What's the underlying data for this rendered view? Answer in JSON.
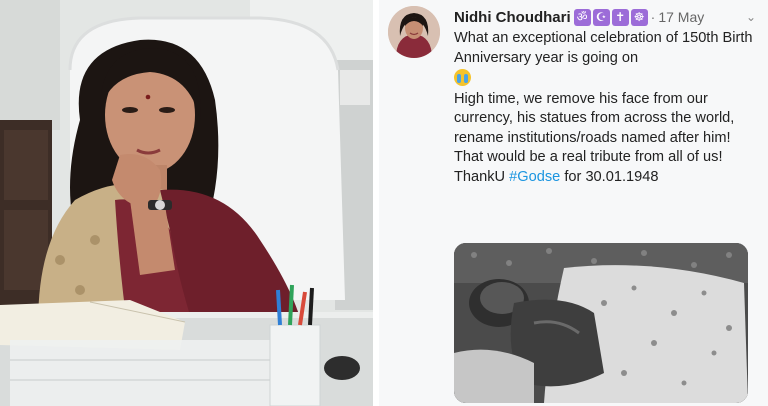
{
  "tweet": {
    "author_name": "Nidhi Choudhari",
    "name_emojis": [
      "ॐ",
      "☪",
      "✝",
      "☸"
    ],
    "separator": "·",
    "date": "17 May",
    "chevron": "⌄",
    "paragraphs": [
      "What an exceptional celebration of 150th Birth Anniversary year is going on",
      "High time, we remove his face from our currency, his statues from across the world, rename institutions/roads named after him!",
      "That would be a real tribute from all of us!"
    ],
    "thanks_prefix": "ThankU",
    "hashtag": "#Godse",
    "thanks_suffix": "for 30.01.1948"
  },
  "colors": {
    "hashtag": "#1b95e0",
    "emoji_badge": "#9c6cd8",
    "tweet_background": "#f7f8f9"
  },
  "icons": {
    "crying_emoji": "loudly-crying-face-emoji",
    "chevron": "chevron-down-icon"
  }
}
